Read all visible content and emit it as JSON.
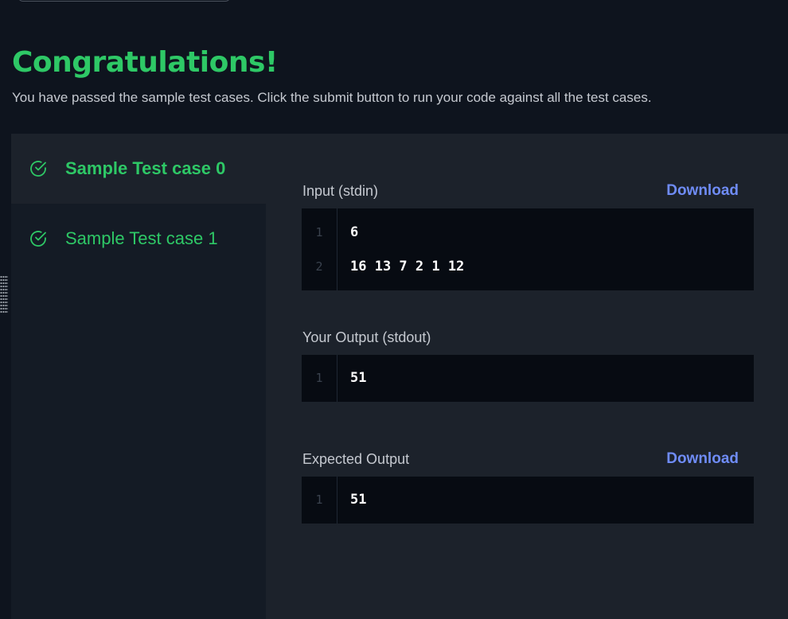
{
  "header": {
    "title": "Congratulations!",
    "subtitle": "You have passed the sample test cases. Click the submit button to run your code against all the test cases."
  },
  "test_cases": [
    {
      "label": "Sample Test case 0",
      "active": true
    },
    {
      "label": "Sample Test case 1",
      "active": false
    }
  ],
  "input": {
    "label": "Input (stdin)",
    "download": "Download",
    "lines": [
      {
        "num": "1",
        "text": "6"
      },
      {
        "num": "2",
        "text": "16 13 7 2 1 12"
      }
    ]
  },
  "your_output": {
    "label": "Your Output (stdout)",
    "lines": [
      {
        "num": "1",
        "text": "51"
      }
    ]
  },
  "expected_output": {
    "label": "Expected Output",
    "download": "Download",
    "lines": [
      {
        "num": "1",
        "text": "51"
      }
    ]
  },
  "colors": {
    "success": "#2ec866",
    "link": "#6f8cf7",
    "background": "#0e141e",
    "panel": "#1c222b",
    "code_bg": "#070b12"
  },
  "icons": {
    "test_case_status": "check-circle-icon"
  }
}
